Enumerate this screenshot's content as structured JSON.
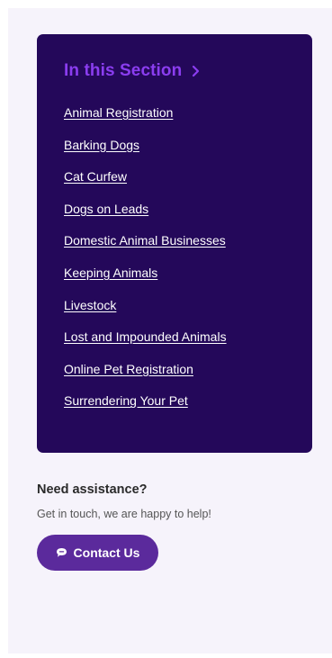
{
  "section": {
    "heading": "In this Section",
    "heading_icon": "chevron-right-icon",
    "links": [
      "Animal Registration",
      "Barking Dogs",
      "Cat Curfew",
      "Dogs on Leads",
      "Domestic Animal Businesses",
      "Keeping Animals",
      "Livestock",
      "Lost and Impounded Animals",
      "Online Pet Registration",
      "Surrendering Your Pet"
    ]
  },
  "assistance": {
    "title": "Need assistance?",
    "subtitle": "Get in touch, we are happy to help!",
    "button_label": "Contact Us",
    "button_icon": "chat-bubble-icon"
  },
  "colors": {
    "card_background": "#24085a",
    "heading_accent": "#8b3df0",
    "button_background": "#5b2a9c",
    "page_background": "#f6f3fb"
  }
}
